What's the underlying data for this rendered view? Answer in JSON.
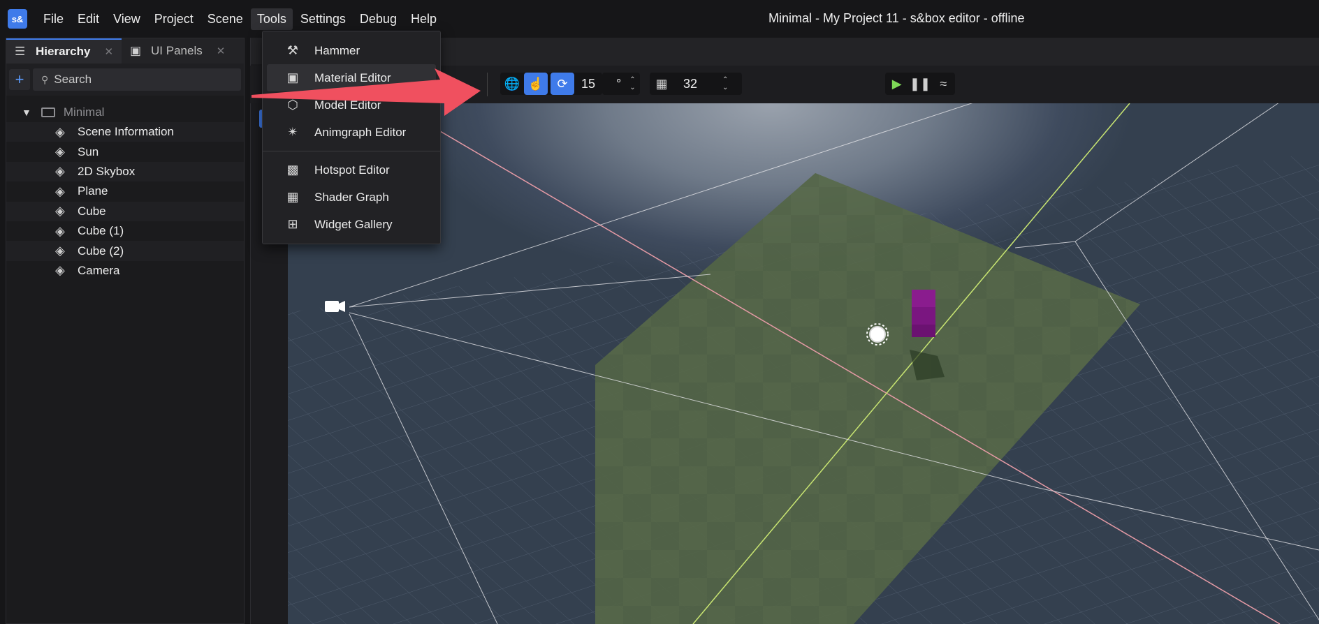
{
  "app": {
    "logo_text": "s&",
    "window_title": "Minimal - My Project 11 - s&box editor - offline",
    "brand_color": "#3f7bea"
  },
  "menubar": {
    "items": [
      "File",
      "Edit",
      "View",
      "Project",
      "Scene",
      "Tools",
      "Settings",
      "Debug",
      "Help"
    ],
    "active": "Tools"
  },
  "tools_menu": {
    "items": [
      {
        "label": "Hammer",
        "icon": "hammer-icon"
      },
      {
        "label": "Material Editor",
        "icon": "image-icon"
      },
      {
        "label": "Model Editor",
        "icon": "cube-outline-icon"
      },
      {
        "label": "Animgraph Editor",
        "icon": "running-person-icon"
      },
      {
        "label": "Hotspot Editor",
        "icon": "grid-layout-icon"
      },
      {
        "label": "Shader Graph",
        "icon": "checker-icon"
      },
      {
        "label": "Widget Gallery",
        "icon": "widget-grid-icon"
      }
    ],
    "hovered": "Material Editor"
  },
  "left_panel": {
    "tabs": [
      {
        "label": "Hierarchy",
        "icon": "list-icon",
        "active": true
      },
      {
        "label": "UI Panels",
        "icon": "window-icon",
        "active": false
      }
    ],
    "search_placeholder": "Search",
    "root": {
      "label": "Minimal",
      "icon": "scene-image-icon"
    },
    "objects": [
      "Scene Information",
      "Sun",
      "2D Skybox",
      "Plane",
      "Cube",
      "Cube (1)",
      "Cube (2)",
      "Camera"
    ]
  },
  "toolbar": {
    "rotation_snap": "15",
    "rotation_unit": "°",
    "grid_size": "32",
    "play_color": "#7ed957"
  },
  "annotation": {
    "arrow_color": "#f0505f"
  }
}
